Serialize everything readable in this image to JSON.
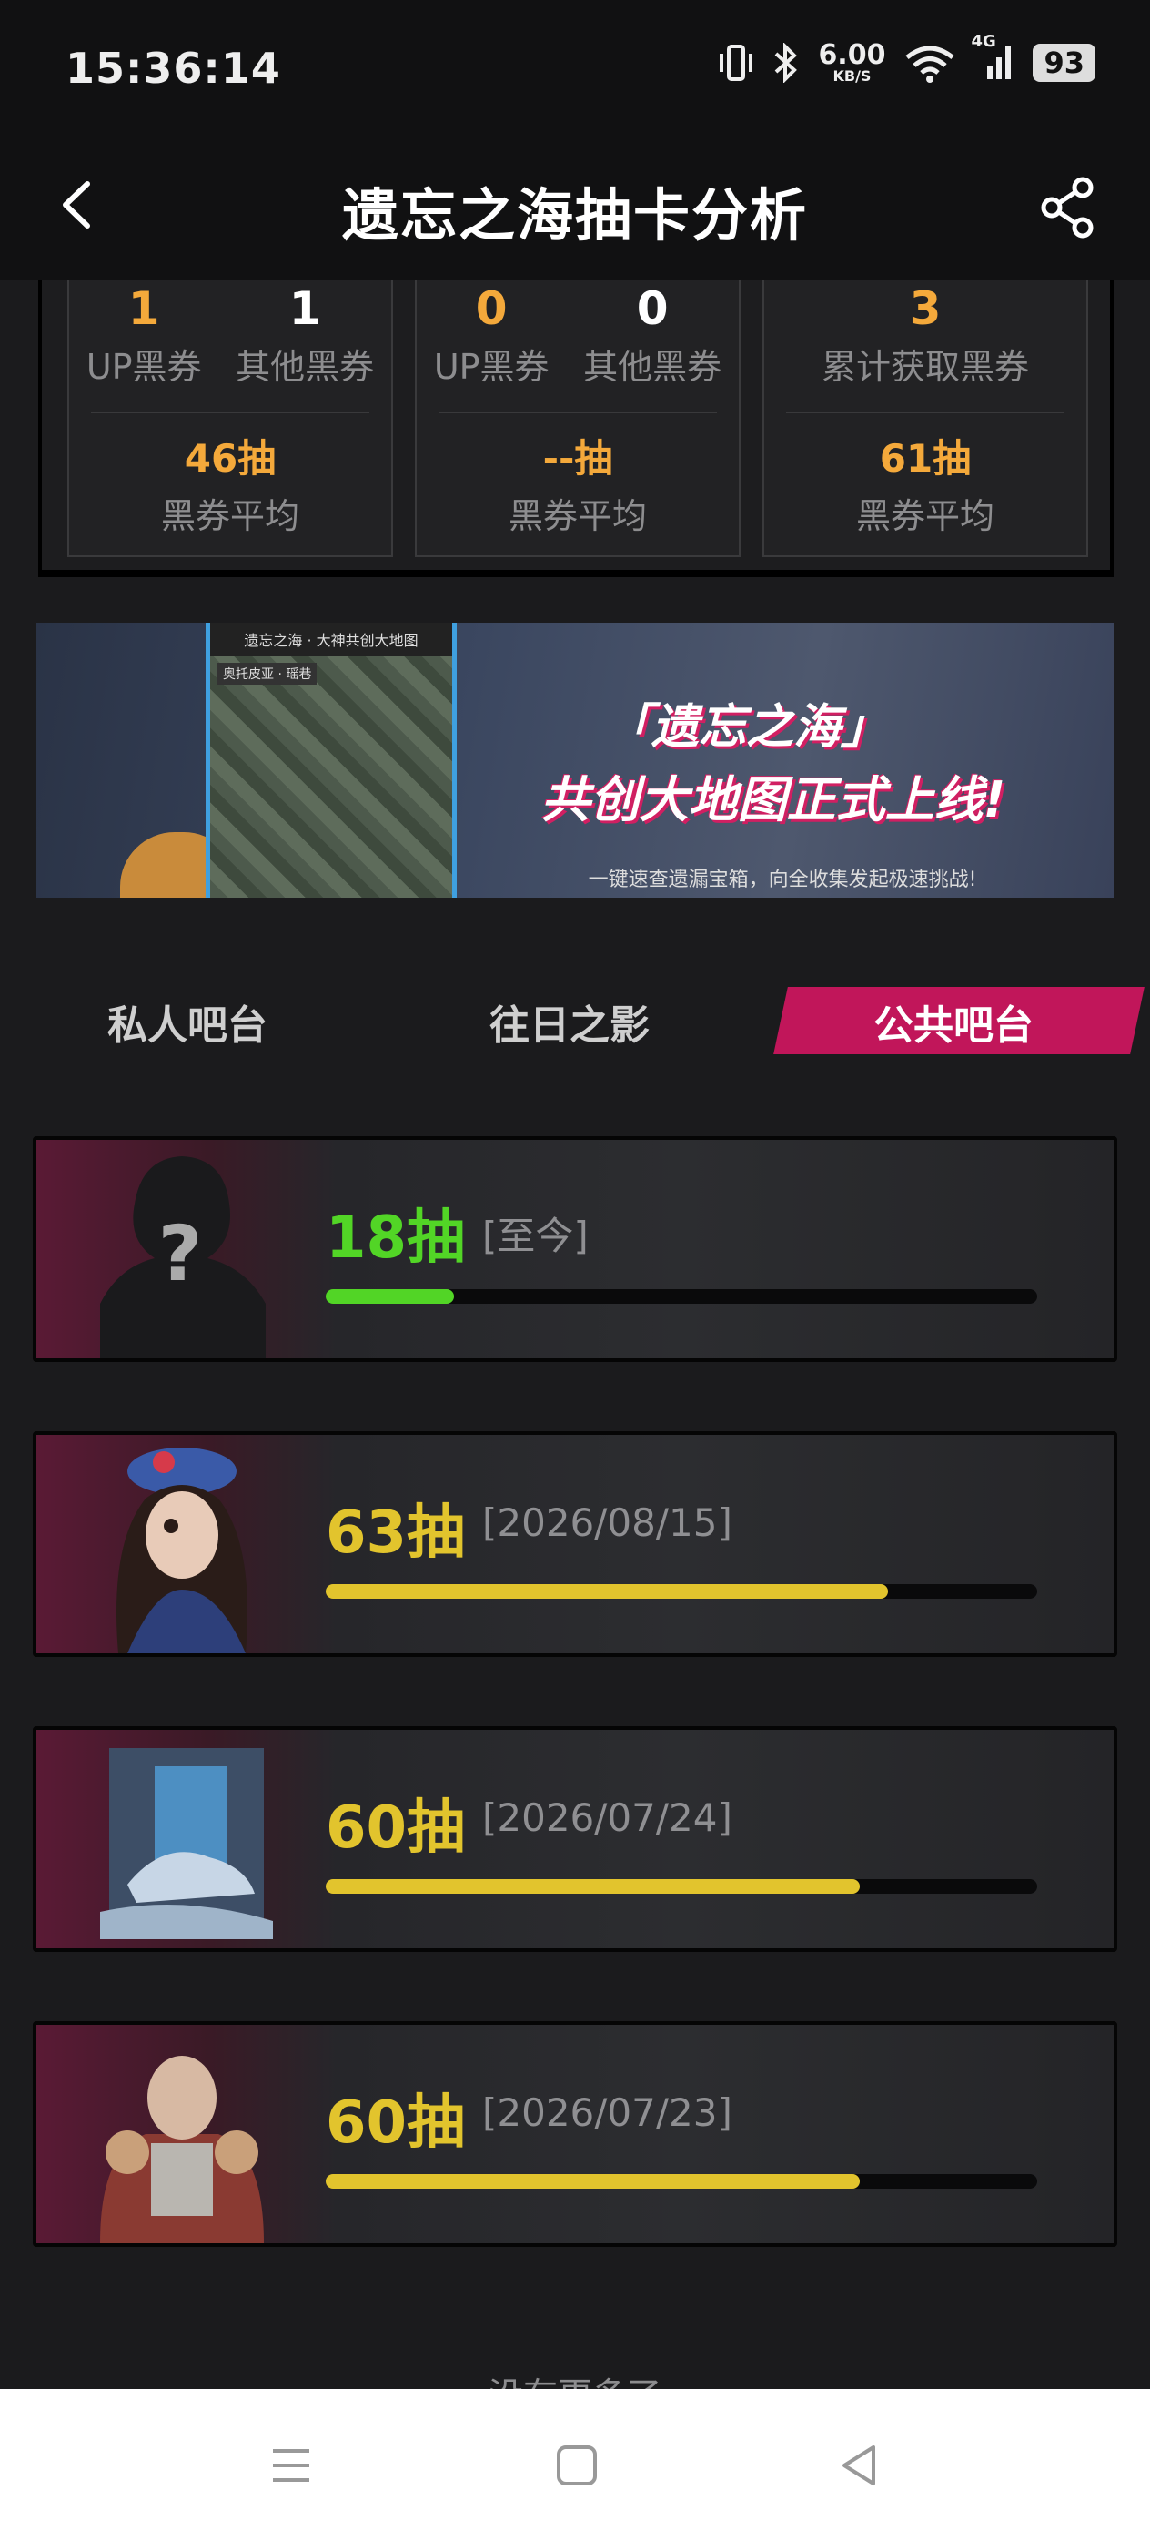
{
  "status_bar": {
    "time": "15:36:14",
    "net_speed": "6.00",
    "net_unit": "KB/S",
    "network": "4G",
    "battery": "93"
  },
  "header": {
    "title": "遗忘之海抽卡分析"
  },
  "stats": [
    {
      "items": [
        {
          "value": "1",
          "label": "UP黑券"
        },
        {
          "value": "1",
          "label": "其他黑券"
        }
      ],
      "avg_value": "46抽",
      "avg_label": "黑券平均"
    },
    {
      "items": [
        {
          "value": "0",
          "label": "UP黑券"
        },
        {
          "value": "0",
          "label": "其他黑券"
        }
      ],
      "avg_value": "--抽",
      "avg_label": "黑券平均"
    },
    {
      "items": [
        {
          "value": "3",
          "label": "累计获取黑券"
        }
      ],
      "avg_value": "61抽",
      "avg_label": "黑券平均"
    }
  ],
  "banner": {
    "map_title": "遗忘之海 · 大神共创大地图",
    "map_sub": "奥托皮亚 · 瑶巷",
    "title_top": "「遗忘之海」",
    "title_main": "共创大地图正式上线!",
    "caption": "一键速查遗漏宝箱，向全收集发起极速挑战!"
  },
  "tabs": [
    {
      "label": "私人吧台",
      "active": false
    },
    {
      "label": "往日之影",
      "active": false
    },
    {
      "label": "公共吧台",
      "active": true
    }
  ],
  "records": [
    {
      "count": "18抽",
      "date": "[至今]",
      "progress": 0.18,
      "color": "#52d526",
      "avatar": "mystery-silhouette"
    },
    {
      "count": "63抽",
      "date": "[2026/08/15]",
      "progress": 0.79,
      "color": "#e2c42d",
      "avatar": "character-doll"
    },
    {
      "count": "60抽",
      "date": "[2026/07/24]",
      "progress": 0.75,
      "color": "#e2c42d",
      "avatar": "item-glass-slipper"
    },
    {
      "count": "60抽",
      "date": "[2026/07/23]",
      "progress": 0.75,
      "color": "#e2c42d",
      "avatar": "character-armored"
    }
  ],
  "footer_hint": "没有更多了",
  "colors": {
    "accent_orange": "#f4a93b",
    "tab_active": "#c1165a",
    "progress_green": "#52d526",
    "progress_yellow": "#e2c42d"
  }
}
